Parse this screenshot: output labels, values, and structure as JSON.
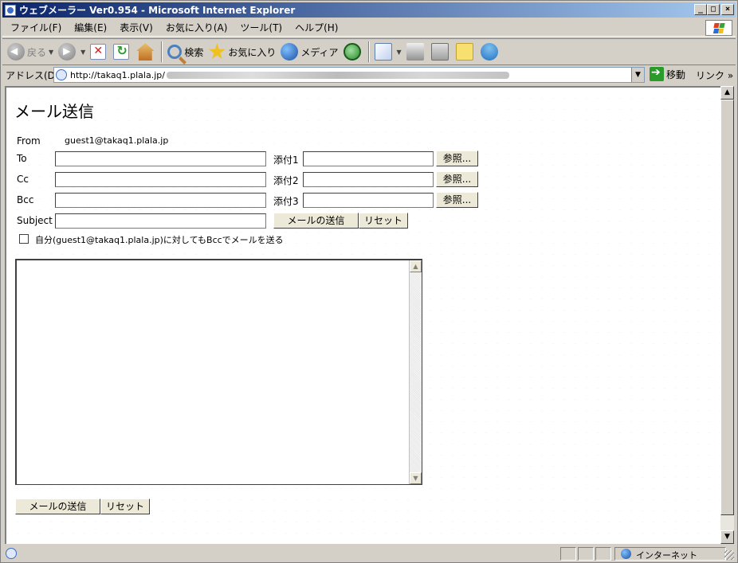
{
  "window": {
    "title": "ウェブメーラー Ver0.954 - Microsoft Internet Explorer",
    "min_label": "_",
    "max_label": "□",
    "close_label": "×"
  },
  "menu": {
    "items": [
      "ファイル(F)",
      "編集(E)",
      "表示(V)",
      "お気に入り(A)",
      "ツール(T)",
      "ヘルプ(H)"
    ]
  },
  "toolbar": {
    "back_label": "戻る",
    "search_label": "検索",
    "favorites_label": "お気に入り",
    "media_label": "メディア"
  },
  "address": {
    "label": "アドレス(D)",
    "url": "http://takaq1.plala.jp/",
    "go_label": "移動",
    "links_label": "リンク »"
  },
  "form": {
    "title": "メール送信",
    "from_label": "From",
    "from_value": "guest1@takaq1.plala.jp",
    "to_label": "To",
    "cc_label": "Cc",
    "bcc_label": "Bcc",
    "subject_label": "Subject",
    "attach1_label": "添付1",
    "attach2_label": "添付2",
    "attach3_label": "添付3",
    "browse_label": "参照...",
    "send_label": "メールの送信",
    "reset_label": "リセット",
    "bcc_self_label": "自分(guest1@takaq1.plala.jp)に対してもBccでメールを送る",
    "to_value": "",
    "cc_value": "",
    "bcc_value": "",
    "subject_value": "",
    "body_value": ""
  },
  "status": {
    "zone": "インターネット"
  }
}
